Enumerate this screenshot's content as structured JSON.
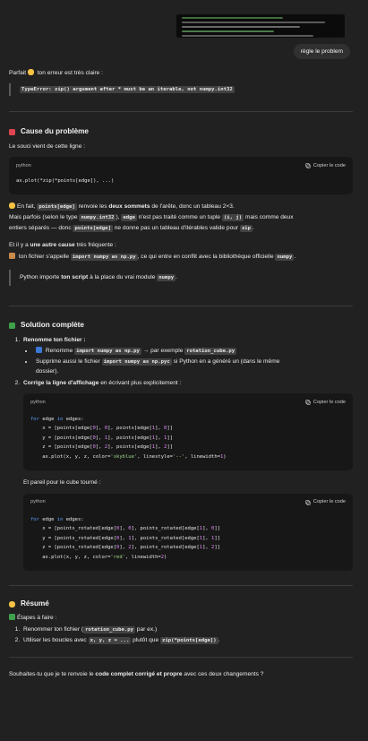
{
  "user": {
    "bubble": "règle le problem",
    "screenshot_lines": 7
  },
  "intro": {
    "a": "Parfait ",
    "b": " ton erreur est très claire :",
    "error": "TypeError: zip() argument after * must be an iterable, not numpy.int32"
  },
  "cause": {
    "title": "Cause du problème",
    "lead": "Le souci vient de cette ligne :",
    "code_lang": "python",
    "copy_label": "Copier le code",
    "code_line": "ax.plot(*zip(*points[edge]), ...)",
    "p1_a": "En fait, ",
    "p1_code": "points[edge]",
    "p1_b": " renvoie les ",
    "p1_bold": "deux sommets",
    "p1_c": " de l'arête, donc un tableau 2×3.",
    "p2_a": "Mais parfois (selon le type ",
    "p2_code1": "numpy.int32",
    "p2_b": "), ",
    "p2_code2": "edge",
    "p2_c": " n'est pas traité comme un tuple ",
    "p2_code3": "(i, j)",
    "p2_d": " mais comme deux",
    "p3_a": "entiers séparés — donc ",
    "p3_code": "points[edge]",
    "p3_b": " ne donne pas un tableau d'itérables valide pour ",
    "p3_code2": "zip",
    "p3_c": ".",
    "p4_a": "Et il y a ",
    "p4_bold": "une autre cause",
    "p4_b": " très fréquente :",
    "p5_a": " ton fichier s'appelle ",
    "p5_code": "import numpy as np.py",
    "p5_b": ", ce qui entre en conflit avec la bibliothèque officielle ",
    "p5_code2": "numpy",
    "p5_c": ".",
    "quote_a": "Python importe ",
    "quote_bold": "ton script",
    "quote_b": " à la place du vrai module ",
    "quote_code": "numpy",
    "quote_c": "."
  },
  "solution": {
    "title": "Solution complète",
    "s1_title": "Renomme ton fichier :",
    "s1_b1_a": " Renomme ",
    "s1_b1_code": "import numpy as np.py",
    "s1_b1_b": " → par exemple ",
    "s1_b1_code2": "rotation_cube.py",
    "s1_b2_a": "Supprime aussi le fichier ",
    "s1_b2_code": "import numpy as np.pyc",
    "s1_b2_b": " si Python en a généré un (dans le même",
    "s1_b2_c": "dossier).",
    "s2_title": "Corrige la ligne d'affichage",
    "s2_rest": " en écrivant plus explicitement :",
    "code_lang": "python",
    "copy_label": "Copier le code",
    "cube_lead": "Et pareil pour le cube tourné :"
  },
  "summary": {
    "title": "Résumé",
    "steps_label": "Étapes à faire :",
    "i1_a": "Renommer ton fichier (",
    "i1_code": "rotation_cube.py",
    "i1_b": " par ex.)",
    "i2_a": "Utiliser les boucles avec ",
    "i2_code": "x, y, z = ...",
    "i2_b": " plutôt que ",
    "i2_code2": "zip(*points[edge])",
    "i2_c": ".",
    "final_a": "Souhaites-tu que je te renvoie le ",
    "final_bold": "code complet corrigé et propre",
    "final_b": " avec ces deux changements ?"
  },
  "colors": {
    "background": "#212121",
    "code_background": "#171717",
    "keyword": "#5aa0ff",
    "number": "#e48aff",
    "string": "#9fd98b"
  }
}
